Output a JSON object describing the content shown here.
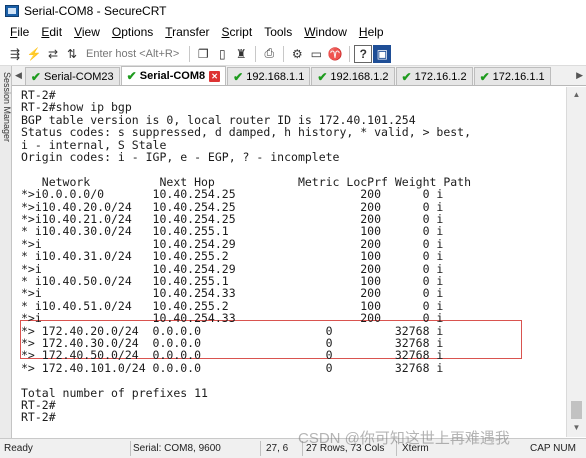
{
  "window": {
    "title": "Serial-COM8 - SecureCRT"
  },
  "menu": {
    "items": [
      {
        "label": "File",
        "key": "F",
        "rest": "ile"
      },
      {
        "label": "Edit",
        "key": "E",
        "rest": "dit"
      },
      {
        "label": "View",
        "key": "V",
        "rest": "iew"
      },
      {
        "label": "Options",
        "key": "O",
        "rest": "ptions"
      },
      {
        "label": "Transfer",
        "key": "T",
        "rest": "ransfer"
      },
      {
        "label": "Script",
        "key": "S",
        "rest": "cript"
      },
      {
        "label": "Tools",
        "key": "",
        "rest": "Tools"
      },
      {
        "label": "Window",
        "key": "W",
        "rest": "indow"
      },
      {
        "label": "Help",
        "key": "H",
        "rest": "elp"
      }
    ]
  },
  "toolbar": {
    "host_placeholder": "Enter host <Alt+R>"
  },
  "tabs": [
    {
      "label": "Serial-COM23",
      "active": false
    },
    {
      "label": "Serial-COM8",
      "active": true
    },
    {
      "label": "192.168.1.1",
      "active": false
    },
    {
      "label": "192.168.1.2",
      "active": false
    },
    {
      "label": "172.16.1.2",
      "active": false
    },
    {
      "label": "172.16.1.1",
      "active": false
    }
  ],
  "side_panel": {
    "label": "Session Manager"
  },
  "terminal": {
    "lines": [
      "RT-2#",
      "RT-2#show ip bgp",
      "BGP table version is 0, local router ID is 172.40.101.254",
      "Status codes: s suppressed, d damped, h history, * valid, > best,",
      "i - internal, S Stale",
      "Origin codes: i - IGP, e - EGP, ? - incomplete",
      "",
      "   Network          Next Hop            Metric LocPrf Weight Path",
      "*>i0.0.0.0/0       10.40.254.25                  200      0 i",
      "*>i10.40.20.0/24   10.40.254.25                  200      0 i",
      "*>i10.40.21.0/24   10.40.254.25                  200      0 i",
      "* i10.40.30.0/24   10.40.255.1                   100      0 i",
      "*>i                10.40.254.29                  200      0 i",
      "* i10.40.31.0/24   10.40.255.2                   100      0 i",
      "*>i                10.40.254.29                  200      0 i",
      "* i10.40.50.0/24   10.40.255.1                   100      0 i",
      "*>i                10.40.254.33                  200      0 i",
      "* i10.40.51.0/24   10.40.255.2                   100      0 i",
      "*>i                10.40.254.33                  200      0 i",
      "*> 172.40.20.0/24  0.0.0.0                  0         32768 i",
      "*> 172.40.30.0/24  0.0.0.0                  0         32768 i",
      "*> 172.40.50.0/24  0.0.0.0                  0         32768 i",
      "*> 172.40.101.0/24 0.0.0.0                  0         32768 i",
      "",
      "Total number of prefixes 11",
      "RT-2#",
      "RT-2#"
    ]
  },
  "statusbar": {
    "ready": "Ready",
    "serial": "Serial: COM8, 9600",
    "cursor": "27,  6",
    "size": "27 Rows, 73 Cols",
    "term": "Xterm",
    "caps": "CAP  NUM"
  },
  "watermark": "CSDN @你可知这世上再难遇我",
  "colors": {
    "highlight": "#d9534f",
    "tab_check": "#1e9b1e",
    "tab_close": "#dd3333"
  },
  "icons": {
    "toolbar": [
      "connect-icon",
      "quick-connect-icon",
      "reconnect-icon",
      "disconnect-icon",
      "copy-icon",
      "paste-icon",
      "find-icon",
      "print-icon",
      "settings-icon",
      "map-icon",
      "help-icon",
      "question-icon"
    ]
  }
}
